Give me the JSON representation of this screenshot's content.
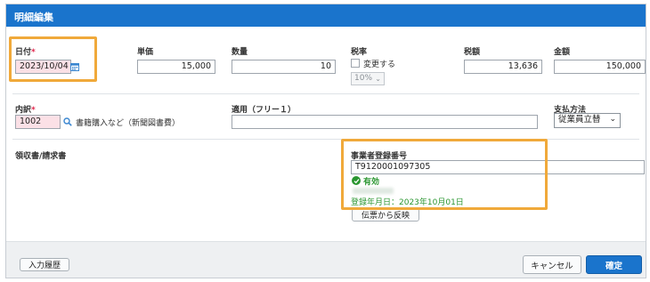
{
  "dialog": {
    "title": "明細編集"
  },
  "date": {
    "label": "日付",
    "required_mark": "*",
    "value": "2023/10/04"
  },
  "unit_price": {
    "label": "単価",
    "value": "15,000"
  },
  "quantity": {
    "label": "数量",
    "value": "10"
  },
  "tax_rate": {
    "label": "税率",
    "change_label": "変更する",
    "change_checked": false,
    "select_value": "10%"
  },
  "tax_amount": {
    "label": "税額",
    "value": "13,636"
  },
  "amount": {
    "label": "金額",
    "value": "150,000"
  },
  "breakdown": {
    "label": "内訳",
    "required_mark": "*",
    "code": "1002",
    "name": "書籍購入など（新聞図書費）"
  },
  "remarks": {
    "label": "適用（フリー１）",
    "value": ""
  },
  "payment": {
    "label": "支払方法",
    "value": "従業員立替"
  },
  "receipt": {
    "label": "領収書/請求書"
  },
  "registration": {
    "label": "事業者登録番号",
    "value": "T9120001097305",
    "status": "有効",
    "registered_date": "登録年月日：2023年10月01日",
    "reflect_button": "伝票から反映"
  },
  "footer": {
    "history_button": "入力履歴",
    "cancel_button": "キャンセル",
    "confirm_button": "確定"
  },
  "colors": {
    "title_bar": "#1a74cc",
    "highlight": "#f0a93a",
    "required": "#e0234a",
    "valid": "#2a9630"
  },
  "icons": {
    "calendar": "calendar-icon",
    "search": "search-icon",
    "check": "check-circle-icon"
  }
}
